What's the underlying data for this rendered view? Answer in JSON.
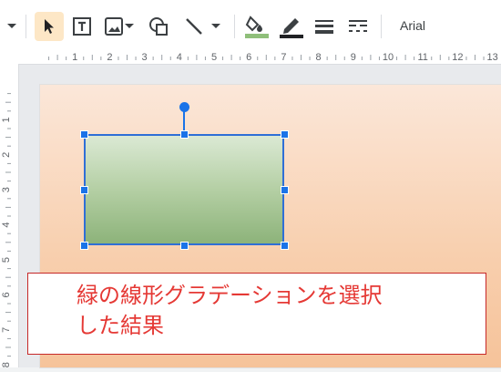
{
  "toolbar": {
    "tools": [
      {
        "name": "more-dropdown-icon"
      },
      {
        "name": "select-icon",
        "active": true
      },
      {
        "name": "text-box-icon"
      },
      {
        "name": "image-icon"
      },
      {
        "name": "shape-icon"
      },
      {
        "name": "line-icon"
      },
      {
        "name": "fill-color-icon",
        "underline_color": "#8fbf7a"
      },
      {
        "name": "border-color-icon",
        "underline_color": "#202124"
      },
      {
        "name": "border-weight-icon"
      },
      {
        "name": "border-dash-icon"
      }
    ],
    "font_name": "Arial"
  },
  "ruler_h": [
    "1",
    "2",
    "3",
    "4",
    "5",
    "6",
    "7",
    "8",
    "9",
    "10",
    "11",
    "12",
    "13"
  ],
  "ruler_v": [
    "1",
    "2",
    "3",
    "4",
    "5",
    "6",
    "7",
    "8"
  ],
  "colors": {
    "accent": "#1a73e8",
    "selected_tool_bg": "#fde7c6",
    "caption_red": "#e53935"
  },
  "caption": {
    "line1": "緑の線形グラデーションを選択",
    "line2": "した結果"
  }
}
